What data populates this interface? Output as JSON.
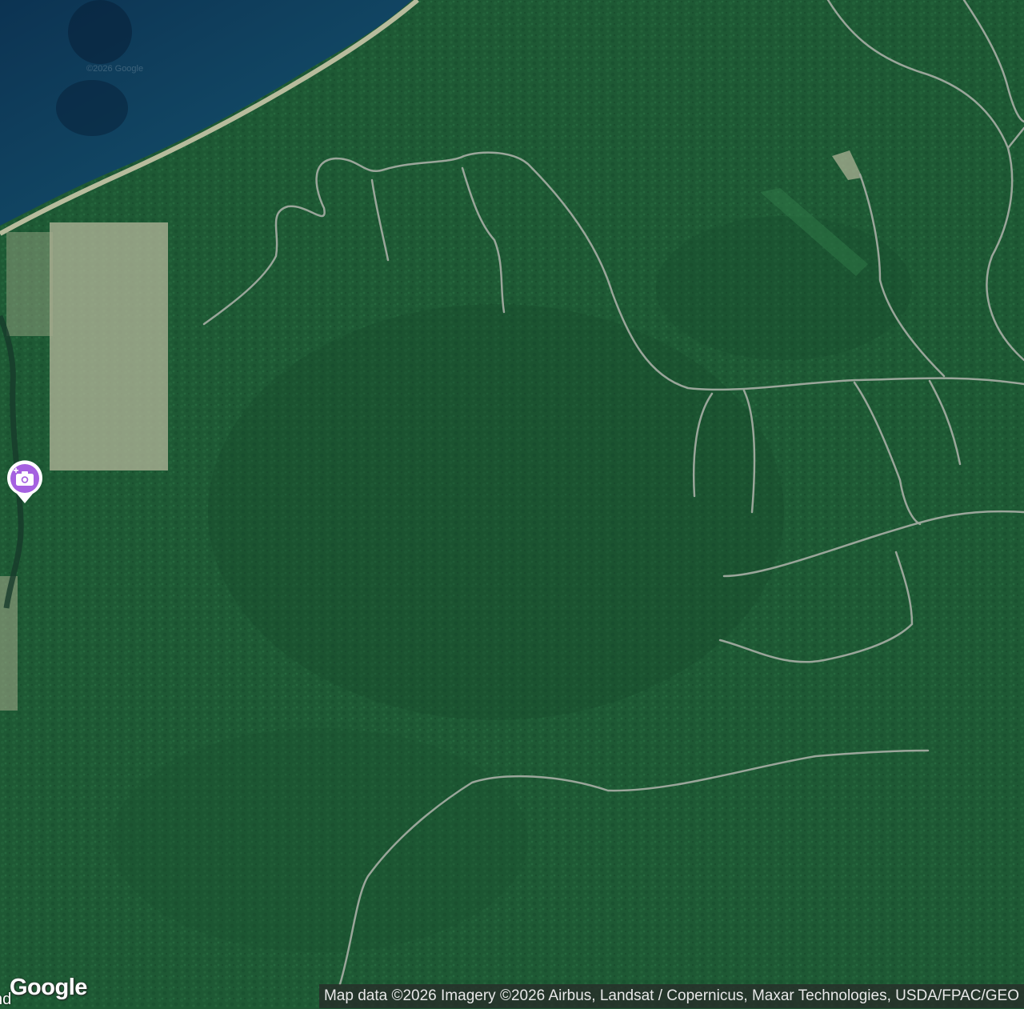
{
  "map": {
    "type": "satellite",
    "watermark": "©2026 Google",
    "partial_place_label": "nd",
    "logo": "Google",
    "attribution": "Map data ©2026 Imagery ©2026 Airbus, Landsat / Copernicus, Maxar Technologies, USDA/FPAC/GEO",
    "pin_icon": "add-photo-icon",
    "colors": {
      "forest": "#1f5a35",
      "water": "#0f3b5a",
      "shore": "#c9c7a8",
      "road": "#9aa69a",
      "clearing": "#b5b79b",
      "pin": "#a561e0"
    }
  }
}
